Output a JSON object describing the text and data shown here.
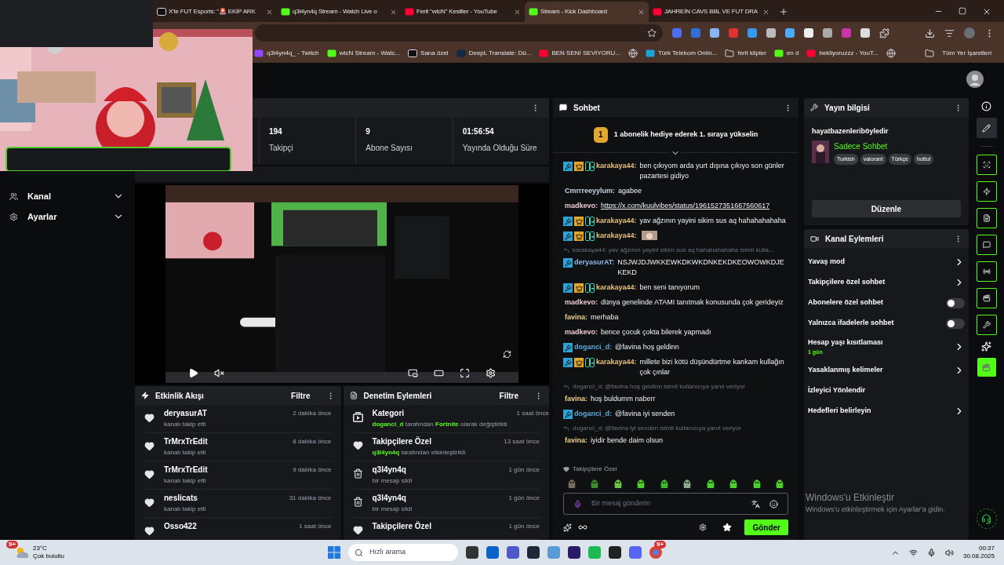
{
  "browser": {
    "tabs": [
      {
        "title": "X'te FUT Esports: \"🚨 EKİP ARK",
        "kind": "x",
        "selected": false
      },
      {
        "title": "q3l4yn4q Stream - Watch Live o",
        "kind": "kick",
        "selected": false
      },
      {
        "title": "Ferit \"wtcN\" Kesitler - YouTube",
        "kind": "youtube",
        "selected": false
      },
      {
        "title": "Stream - Kick Dashboard",
        "kind": "kick",
        "selected": true
      },
      {
        "title": "JAHREİN CAVS BBL VE FUT DRA",
        "kind": "youtube",
        "selected": false
      }
    ],
    "bookmarks": [
      {
        "label": "q3l4yn4q_ - Twitch",
        "kind": "twitch"
      },
      {
        "label": "wtcN Stream - Watc...",
        "kind": "kick"
      },
      {
        "label": "Sana özel",
        "kind": "x"
      },
      {
        "label": "DeepL Translate: Dü...",
        "kind": "deepl"
      },
      {
        "label": "BEN SENİ SEVİYORU...",
        "kind": "youtube"
      },
      {
        "kind": "globe"
      },
      {
        "label": "Türk Telekom Onlin...",
        "kind": "telekom"
      },
      {
        "label": "ferit klipler",
        "kind": "folder"
      },
      {
        "label": "en d",
        "kind": "kick"
      },
      {
        "label": "bekliyoruzzz - YouT...",
        "kind": "youtube"
      },
      {
        "kind": "globe"
      }
    ],
    "all_bookmarks": "Tüm Yer İşaretleri"
  },
  "sidebar": {
    "items": [
      {
        "label": "Kanal",
        "kind": "users"
      },
      {
        "label": "Ayarlar",
        "kind": "gear"
      }
    ]
  },
  "stats": [
    {
      "value": "194",
      "label": "Takipçi"
    },
    {
      "value": "9",
      "label": "Abone Sayısı"
    },
    {
      "value": "01:56:54",
      "label": "Yayında Olduğu Süre"
    }
  ],
  "activity": {
    "title": "Etkinlik Akışı",
    "filter": "Filtre",
    "events": [
      {
        "user": "deryasurAT",
        "action": "kanalı takip etti",
        "time": "2 dakika önce"
      },
      {
        "user": "TrMrxTrEdit",
        "action": "kanalı takip etti",
        "time": "8 dakika önce"
      },
      {
        "user": "TrMrxTrEdit",
        "action": "kanalı takip etti",
        "time": "9 dakika önce"
      },
      {
        "user": "neslicats",
        "action": "kanalı takip etti",
        "time": "31 dakika önce"
      },
      {
        "user": "Osso422",
        "time": "1 saat önce"
      }
    ]
  },
  "moderation": {
    "title": "Denetim Eylemleri",
    "filter": "Filtre",
    "actions": [
      {
        "kind": "category",
        "title": "Kategori",
        "time": "1 saat önce",
        "detail": "**doganci_d** tarafından **Fortnite** olarak değiştirildi"
      },
      {
        "kind": "followers",
        "title": "Takipçilere Özel",
        "time": "13 saat önce",
        "detail": "**q3l4yn4q** tarafından etkinleştirildi"
      },
      {
        "kind": "delete",
        "title": "q3l4yn4q",
        "time": "1 gün önce",
        "detail": "bir mesajı sildi"
      },
      {
        "kind": "delete",
        "title": "q3l4yn4q",
        "time": "1 gün önce",
        "detail": "bir mesajı sildi"
      },
      {
        "kind": "followers",
        "title": "Takipçilere Özel",
        "time": "1 gün önce"
      }
    ]
  },
  "chat": {
    "title": "Sohbet",
    "rank": "1",
    "banner": "1 abonelik hediye ederek 1. sıraya yükselin",
    "messages": [
      {
        "user": "karakaya44:",
        "color": "#e6c07b",
        "moderator": true,
        "subscriber": true,
        "og": true,
        "kind": "text",
        "text": "ben çıkıyom arda yurt dışına çıkıyo son günler pazartesi gidiyo"
      },
      {
        "user": "Cmrrreeyylum:",
        "color": "#c9d4e3",
        "moderator": false,
        "subscriber": false,
        "og": false,
        "kind": "text",
        "text": "agabee"
      },
      {
        "user": "madkevo:",
        "color": "#efc9cf",
        "moderator": false,
        "subscriber": false,
        "og": false,
        "kind": "link",
        "text": "https://x.com/kuulvibes/status/1961527351667560617"
      },
      {
        "user": "karakaya44:",
        "color": "#e6c07b",
        "moderator": true,
        "subscriber": true,
        "og": true,
        "kind": "text",
        "text": "yav ağzının yayini sikim sus aq hahahahahaha"
      },
      {
        "user": "karakaya44:",
        "color": "#e6c07b",
        "moderator": true,
        "subscriber": true,
        "og": true,
        "kind": "emote"
      },
      {
        "user": "deryasurAT:",
        "color": "#8fb8f0",
        "moderator": true,
        "subscriber": false,
        "og": false,
        "kind": "text",
        "reply": "karakaya44: yav ağzının yayini sikim sus aq hahahahahaha isimli kulla...",
        "text": "NSJWJDJWKKEWKDKWKDNKEKDKEOWOWKDJEKEKD"
      },
      {
        "user": "karakaya44:",
        "color": "#e6c07b",
        "moderator": true,
        "subscriber": true,
        "og": true,
        "kind": "text",
        "text": "ben seni tanıyorum"
      },
      {
        "user": "madkevo:",
        "color": "#efc9cf",
        "moderator": false,
        "subscriber": false,
        "og": false,
        "kind": "text",
        "text": "dünya genelinde ATAMI tanıtmak konusunda çok gerideyiz"
      },
      {
        "user": "favina:",
        "color": "#f2d58c",
        "moderator": false,
        "subscriber": false,
        "og": false,
        "kind": "text",
        "text": "merhaba"
      },
      {
        "user": "madkevo:",
        "color": "#efc9cf",
        "moderator": false,
        "subscriber": false,
        "og": false,
        "kind": "text",
        "text": "bence çocuk çokta bilerek yapmadı"
      },
      {
        "user": "doganci_d:",
        "color": "#5aa9dc",
        "moderator": true,
        "subscriber": false,
        "og": false,
        "kind": "text",
        "text": "@favina hoş geldinn"
      },
      {
        "user": "karakaya44:",
        "color": "#e6c07b",
        "moderator": true,
        "subscriber": true,
        "og": true,
        "kind": "text",
        "text": "millete bizi kötü düşündürtme kankam kullağın çok çınlar"
      },
      {
        "user": "favina:",
        "color": "#f2d58c",
        "moderator": false,
        "subscriber": false,
        "og": false,
        "kind": "text",
        "reply": "doganci_d: @favina hoş geldinn isimli kullanıcıya yanıt veriyor",
        "text": "hoş buldumm naberr"
      },
      {
        "user": "doganci_d:",
        "color": "#5aa9dc",
        "moderator": true,
        "subscriber": false,
        "og": false,
        "kind": "text",
        "text": "@favina iyi senden"
      },
      {
        "user": "favina:",
        "color": "#f2d58c",
        "moderator": false,
        "subscriber": false,
        "og": false,
        "kind": "text",
        "reply": "doganci_d: @favina iyi senden isimli kullanıcıya yanıt veriyor",
        "text": "iyidir bende daim olsun"
      }
    ],
    "mode": "Takipçilere Özel",
    "input": {
      "placeholder": "Bir mesaj gönderin"
    },
    "send": "Gönder"
  },
  "stream_info": {
    "title": "Yayın bilgisi",
    "stream_title": "hayatbazenleriböyledir",
    "category": "Sadece Sohbet",
    "tags": [
      "Turkish",
      "valorant",
      "Türkçe",
      "hottul"
    ],
    "edit": "Düzenle"
  },
  "channel_actions": {
    "title": "Kanal Eylemleri",
    "items": [
      {
        "label": "Yavaş mod",
        "kind": "link"
      },
      {
        "label": "Takipçilere özel sohbet",
        "kind": "link"
      },
      {
        "label": "Abonelere özel sohbet",
        "kind": "toggle",
        "on": false
      },
      {
        "label": "Yalnızca ifadelerle sohbet",
        "kind": "toggle",
        "on": false
      },
      {
        "label": "Hesap yaşı kısıtlaması",
        "kind": "link",
        "value": "1 gün"
      },
      {
        "label": "Yasaklanmış kelimeler",
        "kind": "link"
      },
      {
        "label": "İzleyici Yönlendir",
        "kind": "plain"
      },
      {
        "label": "Hedefleri belirleyin",
        "kind": "link"
      }
    ]
  },
  "activation": {
    "title": "Windows'u Etkinleştir",
    "text": "Windows'u etkinleştirmek için Ayarlar'a gidin."
  },
  "taskbar": {
    "weather": {
      "badge": "9+",
      "temp": "23°C",
      "desc": "Çok bulutlu"
    },
    "search": {
      "placeholder": "Hızlı arama"
    },
    "discord_badge": "9+",
    "time": "00:37",
    "date": "30.08.2025"
  }
}
